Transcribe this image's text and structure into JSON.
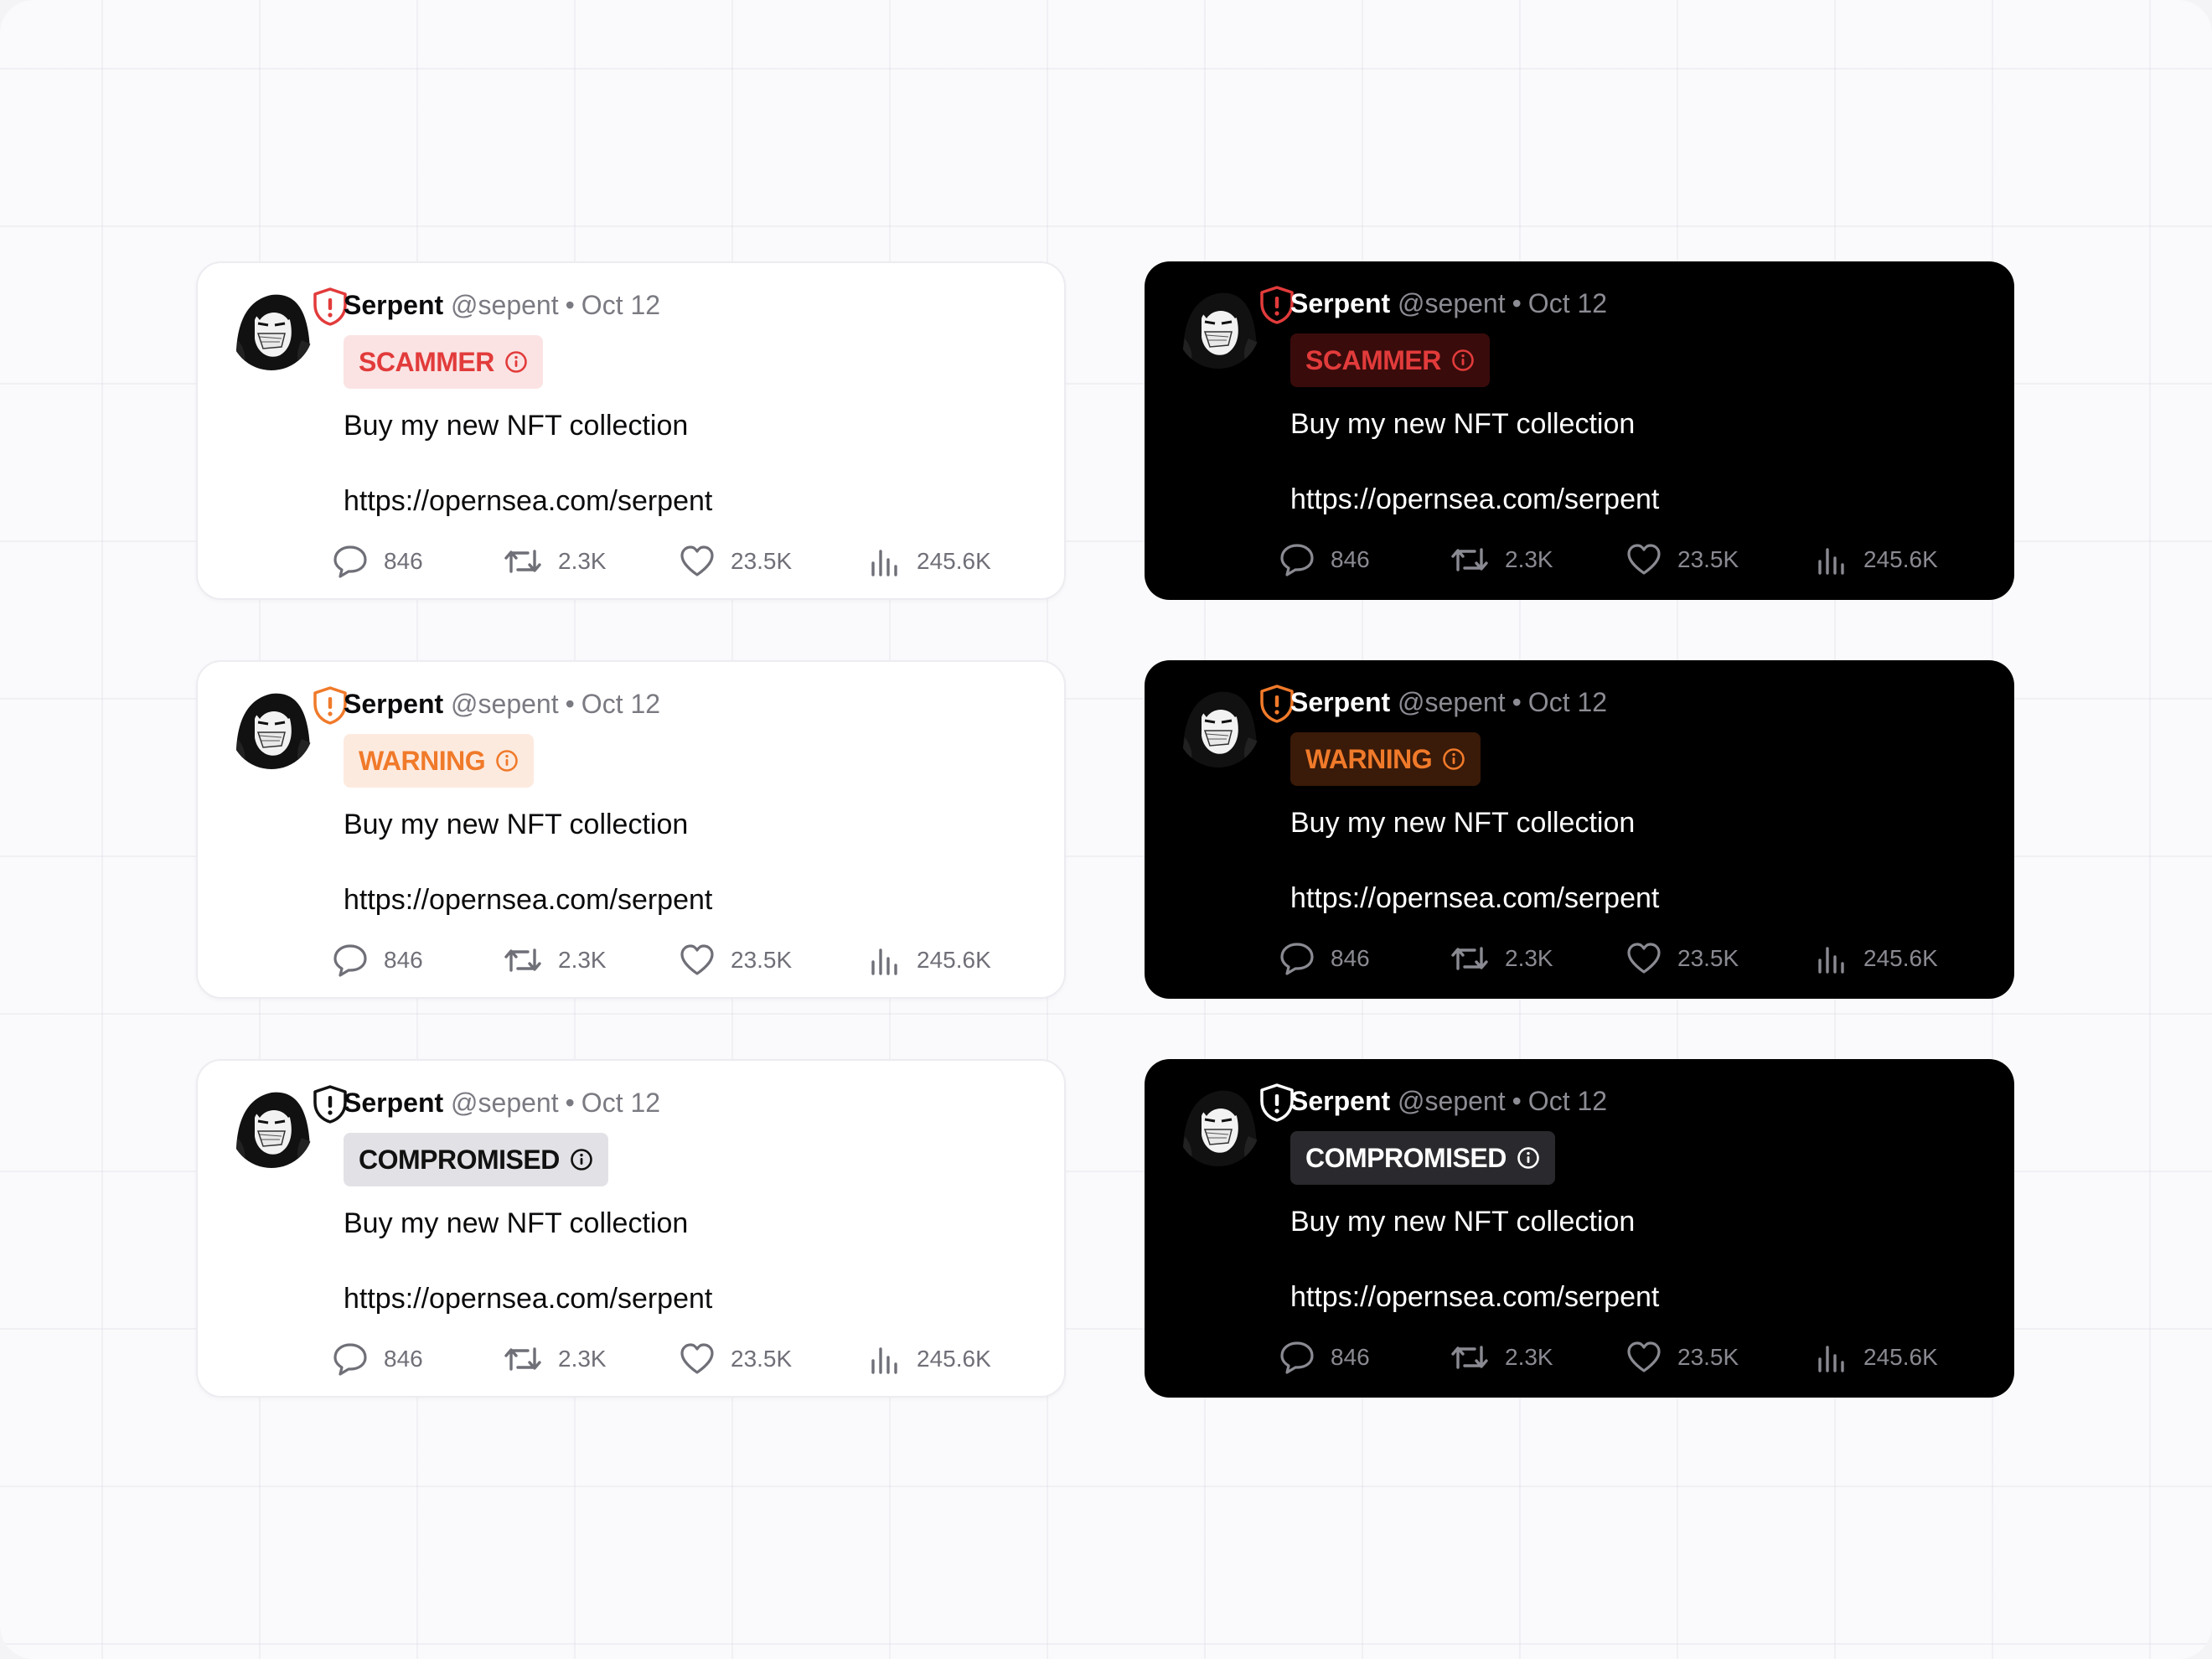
{
  "colors": {
    "scammer": {
      "text": "#e23b3b",
      "bg_light": "#fbe3e3",
      "bg_dark": "#3a0b0b"
    },
    "warning": {
      "text": "#f07a2a",
      "bg_light": "#fdeadf",
      "bg_dark": "#3a1a08"
    },
    "compromised": {
      "text_light": "#111111",
      "bg_light": "#e2e2e6",
      "text_dark": "#ffffff",
      "bg_dark": "#2a2a2e"
    }
  },
  "cards": [
    {
      "theme": "light",
      "status": "scammer",
      "name": "Serpent",
      "handle": "@sepent",
      "separator": "•",
      "date": "Oct 12",
      "badge": "SCAMMER",
      "text": "Buy my new NFT collection",
      "link": "https://opernsea.com/serpent",
      "replies": "846",
      "retweets": "2.3K",
      "likes": "23.5K",
      "views": "245.6K",
      "shield_icon": "shield-alert-icon"
    },
    {
      "theme": "dark",
      "status": "scammer",
      "name": "Serpent",
      "handle": "@sepent",
      "separator": "•",
      "date": "Oct 12",
      "badge": "SCAMMER",
      "text": "Buy my new NFT collection",
      "link": "https://opernsea.com/serpent",
      "replies": "846",
      "retweets": "2.3K",
      "likes": "23.5K",
      "views": "245.6K",
      "shield_icon": "shield-alert-icon"
    },
    {
      "theme": "light",
      "status": "warning",
      "name": "Serpent",
      "handle": "@sepent",
      "separator": "•",
      "date": "Oct 12",
      "badge": "WARNING",
      "text": "Buy my new NFT collection",
      "link": "https://opernsea.com/serpent",
      "replies": "846",
      "retweets": "2.3K",
      "likes": "23.5K",
      "views": "245.6K",
      "shield_icon": "shield-alert-icon"
    },
    {
      "theme": "dark",
      "status": "warning",
      "name": "Serpent",
      "handle": "@sepent",
      "separator": "•",
      "date": "Oct 12",
      "badge": "WARNING",
      "text": "Buy my new NFT collection",
      "link": "https://opernsea.com/serpent",
      "replies": "846",
      "retweets": "2.3K",
      "likes": "23.5K",
      "views": "245.6K",
      "shield_icon": "shield-alert-icon"
    },
    {
      "theme": "light",
      "status": "compromised",
      "name": "Serpent",
      "handle": "@sepent",
      "separator": "•",
      "date": "Oct 12",
      "badge": "COMPROMISED",
      "text": "Buy my new NFT collection",
      "link": "https://opernsea.com/serpent",
      "replies": "846",
      "retweets": "2.3K",
      "likes": "23.5K",
      "views": "245.6K",
      "shield_icon": "shield-alert-icon"
    },
    {
      "theme": "dark",
      "status": "compromised",
      "name": "Serpent",
      "handle": "@sepent",
      "separator": "•",
      "date": "Oct 12",
      "badge": "COMPROMISED",
      "text": "Buy my new NFT collection",
      "link": "https://opernsea.com/serpent",
      "replies": "846",
      "retweets": "2.3K",
      "likes": "23.5K",
      "views": "245.6K",
      "shield_icon": "shield-alert-icon"
    }
  ]
}
